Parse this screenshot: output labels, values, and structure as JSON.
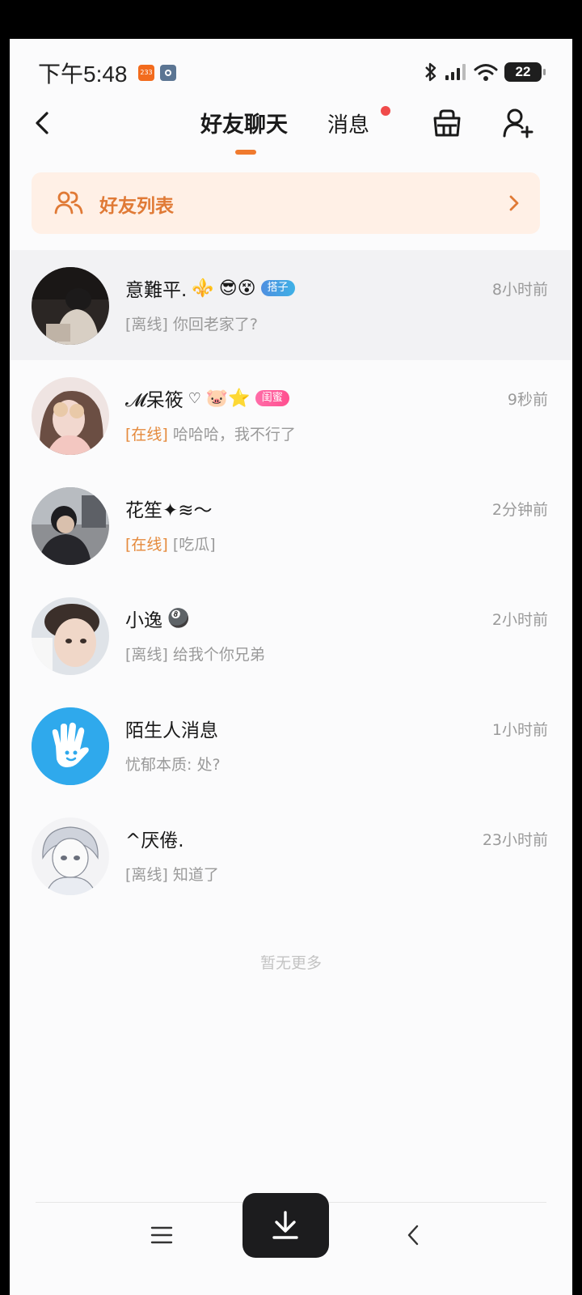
{
  "status_bar": {
    "time": "下午5:48",
    "badge_app": "233",
    "battery": "22"
  },
  "header": {
    "tab_friends": "好友聊天",
    "tab_messages": "消息",
    "accent_color": "#f07a2e"
  },
  "friend_list_banner": {
    "label": "好友列表"
  },
  "chats": [
    {
      "name": "意難平.",
      "name_deco": "⚜️",
      "tag_emoji": "😎😵",
      "tag": "搭子",
      "time": "8小时前",
      "status": "[离线]",
      "message": "你回老家了?",
      "online": false
    },
    {
      "name": "𝓜呆筱",
      "name_deco": "♡",
      "tag_emoji": "🐷⭐",
      "tag": "闺蜜",
      "time": "9秒前",
      "status": "[在线]",
      "message": "哈哈哈，我不行了",
      "online": true
    },
    {
      "name": "花笙✦≋〜",
      "time": "2分钟前",
      "status": "[在线]",
      "message": "[吃瓜]",
      "online": true
    },
    {
      "name": "小逸",
      "name_deco": "🎱",
      "time": "2小时前",
      "status": "[离线]",
      "message": "给我个你兄弟",
      "online": false
    },
    {
      "name": "陌生人消息",
      "time": "1小时前",
      "message": "忧郁本质: 处?"
    },
    {
      "name": "^厌倦.",
      "time": "23小时前",
      "status": "[离线]",
      "message": "知道了",
      "online": false
    }
  ],
  "footer": {
    "no_more": "暂无更多"
  }
}
